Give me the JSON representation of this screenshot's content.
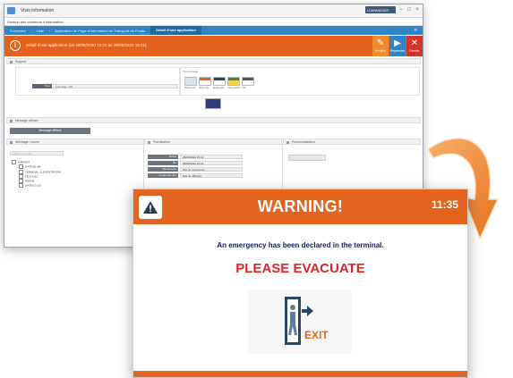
{
  "window": {
    "title": "Visio Information",
    "menu": "Gestion des contenus d'information",
    "user": "U.MANAGER",
    "controls": {
      "minimize": "–",
      "maximize": "□",
      "close": "×"
    }
  },
  "breadcrumb": {
    "items": [
      "Exemples",
      "Liste",
      "Application de Page d'Information de Transport de Fonds",
      "Détail d'une application"
    ],
    "end_icon": "«"
  },
  "header": {
    "title": "Détail d'une application (du 28/05/2020 15:21 au 28/05/2222 15:21)",
    "actions": [
      {
        "label": "Modifier",
        "icon": "✎"
      },
      {
        "label": "Reprendre",
        "icon": "▶"
      },
      {
        "label": "Fermer",
        "icon": "✕"
      }
    ]
  },
  "sections": {
    "s1": "Support",
    "s2": "Message diffusé",
    "s3": "Affichage / zones",
    "s4": "Planification",
    "s5": "Personnalisation"
  },
  "form": {
    "type_label": "Type",
    "type_value": "Full page - FR",
    "model_label": "Type of page",
    "thumbs": [
      "Welcome",
      "Warning",
      "Evacuate",
      "Information",
      "Info"
    ],
    "message_btn": "Message diffusé"
  },
  "tree": {
    "search_placeholder": "Filtrer les zones",
    "root": "AIRPORT",
    "children": [
      "GATE-B1-B4",
      "TERMINAL_2_EVENTROOM",
      "FIDS A-B1",
      "FIDS-B",
      "GATE-C1-C6"
    ]
  },
  "planning": {
    "rows": [
      "Début",
      "Fin",
      "Récurrence",
      "Comportement d'affichage"
    ],
    "values": [
      "28/05/2020 15:21",
      "28/05/2222 15:21",
      "Pas de récurrence",
      "Pas de diffusion"
    ]
  },
  "preview": {
    "title": "WARNING!",
    "time": "11:35",
    "message": "An emergency has been declared in the terminal.",
    "instruction": "PLEASE EVACUATE",
    "exit_label": "EXIT"
  },
  "colors": {
    "orange": "#e3641f",
    "blue": "#2f84c7",
    "red": "#e02424",
    "navy": "#141a5e"
  }
}
